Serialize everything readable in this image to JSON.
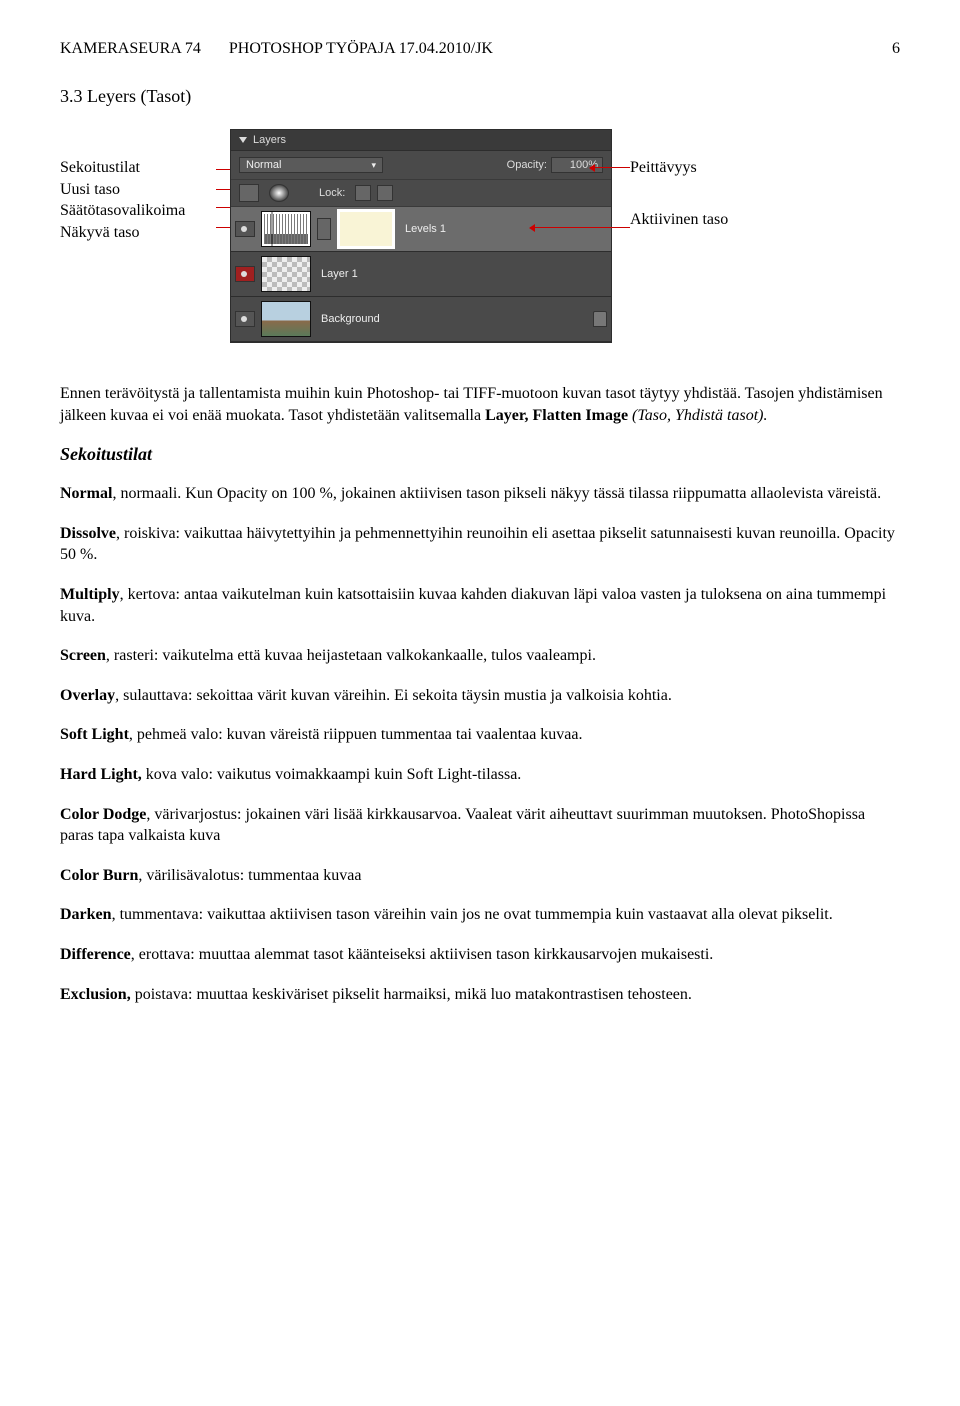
{
  "header": {
    "left": "KAMERASEURA 74",
    "mid": "PHOTOSHOP TYÖPAJA 17.04.2010/JK",
    "page": "6"
  },
  "section_heading": "3.3 Leyers (Tasot)",
  "left_labels": {
    "l1": "Sekoitustilat",
    "l2": "Uusi taso",
    "l3": "Säätötasovalikoima",
    "l4": "Näkyvä taso"
  },
  "right_labels": {
    "r1": "Peittävyys",
    "r2": "Aktiivinen taso"
  },
  "panel": {
    "title": "Layers",
    "blend_label": "Normal",
    "opacity_label": "Opacity:",
    "opacity_value": "100%",
    "lock_label": "Lock:",
    "layer1_name": "Levels 1",
    "layer2_name": "Layer 1",
    "layer3_name": "Background"
  },
  "body": {
    "p1a": "Ennen terävöitystä ja tallentamista muihin kuin Photoshop- tai TIFF-muotoon kuvan tasot täytyy yhdistää. Tasojen yhdistämisen jälkeen kuvaa ei voi enää muokata. Tasot yhdistetään valitsemalla ",
    "p1b": "Layer, Flatten Image ",
    "p1c": "(Taso, Yhdistä tasot).",
    "sekoit": "Sekoitustilat",
    "p2a": "Normal",
    "p2b": ", normaali. Kun Opacity on 100 %, jokainen aktiivisen tason pikseli näkyy tässä tilassa riippumatta allaolevista väreistä.",
    "p3a": "Dissolve",
    "p3b": ", roiskiva: vaikuttaa häivytettyihin ja pehmennettyihin reunoihin eli asettaa pikselit satunnaisesti kuvan reunoilla. Opacity 50 %.",
    "p4a": "Multiply",
    "p4b": ", kertova: antaa vaikutelman kuin katsottaisiin kuvaa kahden diakuvan läpi valoa vasten ja tuloksena on aina tummempi kuva.",
    "p5a": "Screen",
    "p5b": ", rasteri: vaikutelma että kuvaa heijastetaan valkokankaalle, tulos vaaleampi.",
    "p6a": "Overlay",
    "p6b": ", sulauttava: sekoittaa värit kuvan väreihin. Ei sekoita täysin mustia ja valkoisia kohtia.",
    "p7a": "Soft Light",
    "p7b": ", pehmeä valo: kuvan väreistä riippuen tummentaa tai vaalentaa kuvaa.",
    "p8a": "Hard Light,",
    "p8b": " kova valo: vaikutus voimakkaampi kuin Soft Light-tilassa.",
    "p9a": "Color Dodge",
    "p9b": ", värivarjostus: jokainen väri lisää kirkkausarvoa. Vaaleat värit aiheuttavt suurimman muutoksen. PhotoShopissa paras tapa valkaista kuva",
    "p10a": "Color Burn",
    "p10b": ", värilisävalotus: tummentaa kuvaa",
    "p11a": "Darken",
    "p11b": ", tummentava: vaikuttaa aktiivisen tason väreihin vain jos ne ovat tummempia kuin vastaavat alla olevat pikselit.",
    "p12a": "Difference",
    "p12b": ", erottava: muuttaa alemmat tasot käänteiseksi aktiivisen tason kirkkausarvojen mukaisesti.",
    "p13a": "Exclusion,",
    "p13b": " poistava: muuttaa keskiväriset pikselit harmaiksi, mikä luo matakontrastisen tehosteen."
  }
}
